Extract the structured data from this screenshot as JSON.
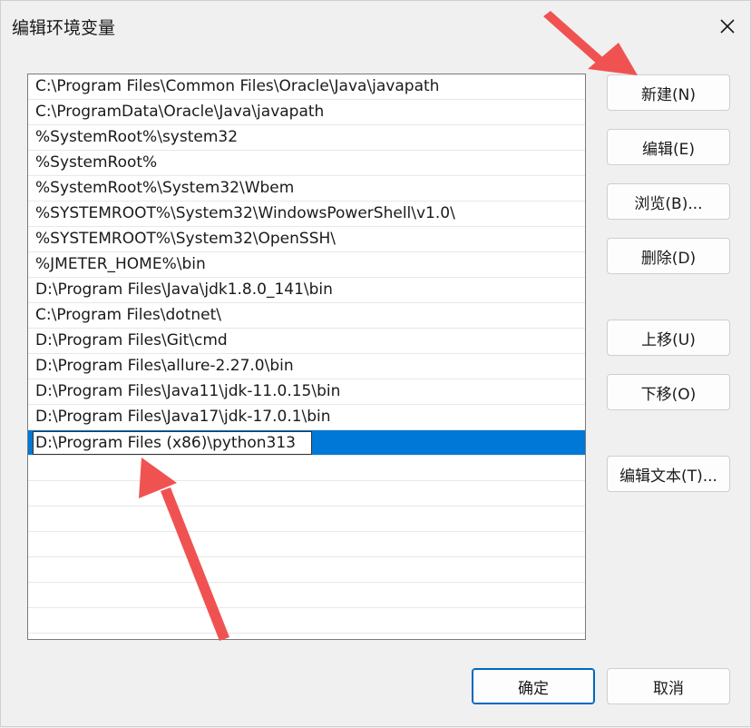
{
  "dialog": {
    "title": "编辑环境变量",
    "close_icon": "close-icon"
  },
  "path_list": {
    "entries": [
      "C:\\Program Files\\Common Files\\Oracle\\Java\\javapath",
      "C:\\ProgramData\\Oracle\\Java\\javapath",
      "%SystemRoot%\\system32",
      "%SystemRoot%",
      "%SystemRoot%\\System32\\Wbem",
      "%SYSTEMROOT%\\System32\\WindowsPowerShell\\v1.0\\",
      "%SYSTEMROOT%\\System32\\OpenSSH\\",
      "%JMETER_HOME%\\bin",
      "D:\\Program Files\\Java\\jdk1.8.0_141\\bin",
      "C:\\Program Files\\dotnet\\",
      "D:\\Program Files\\Git\\cmd",
      "D:\\Program Files\\allure-2.27.0\\bin",
      "D:\\Program Files\\Java11\\jdk-11.0.15\\bin",
      "D:\\Program Files\\Java17\\jdk-17.0.1\\bin"
    ],
    "editing_value": "D:\\Program Files (x86)\\python313"
  },
  "buttons": {
    "new": "新建(N)",
    "edit": "编辑(E)",
    "browse": "浏览(B)...",
    "delete": "删除(D)",
    "move_up": "上移(U)",
    "move_down": "下移(O)",
    "edit_text": "编辑文本(T)...",
    "ok": "确定",
    "cancel": "取消"
  },
  "colors": {
    "selection": "#0078d7",
    "annotation_arrow": "#f05252"
  }
}
